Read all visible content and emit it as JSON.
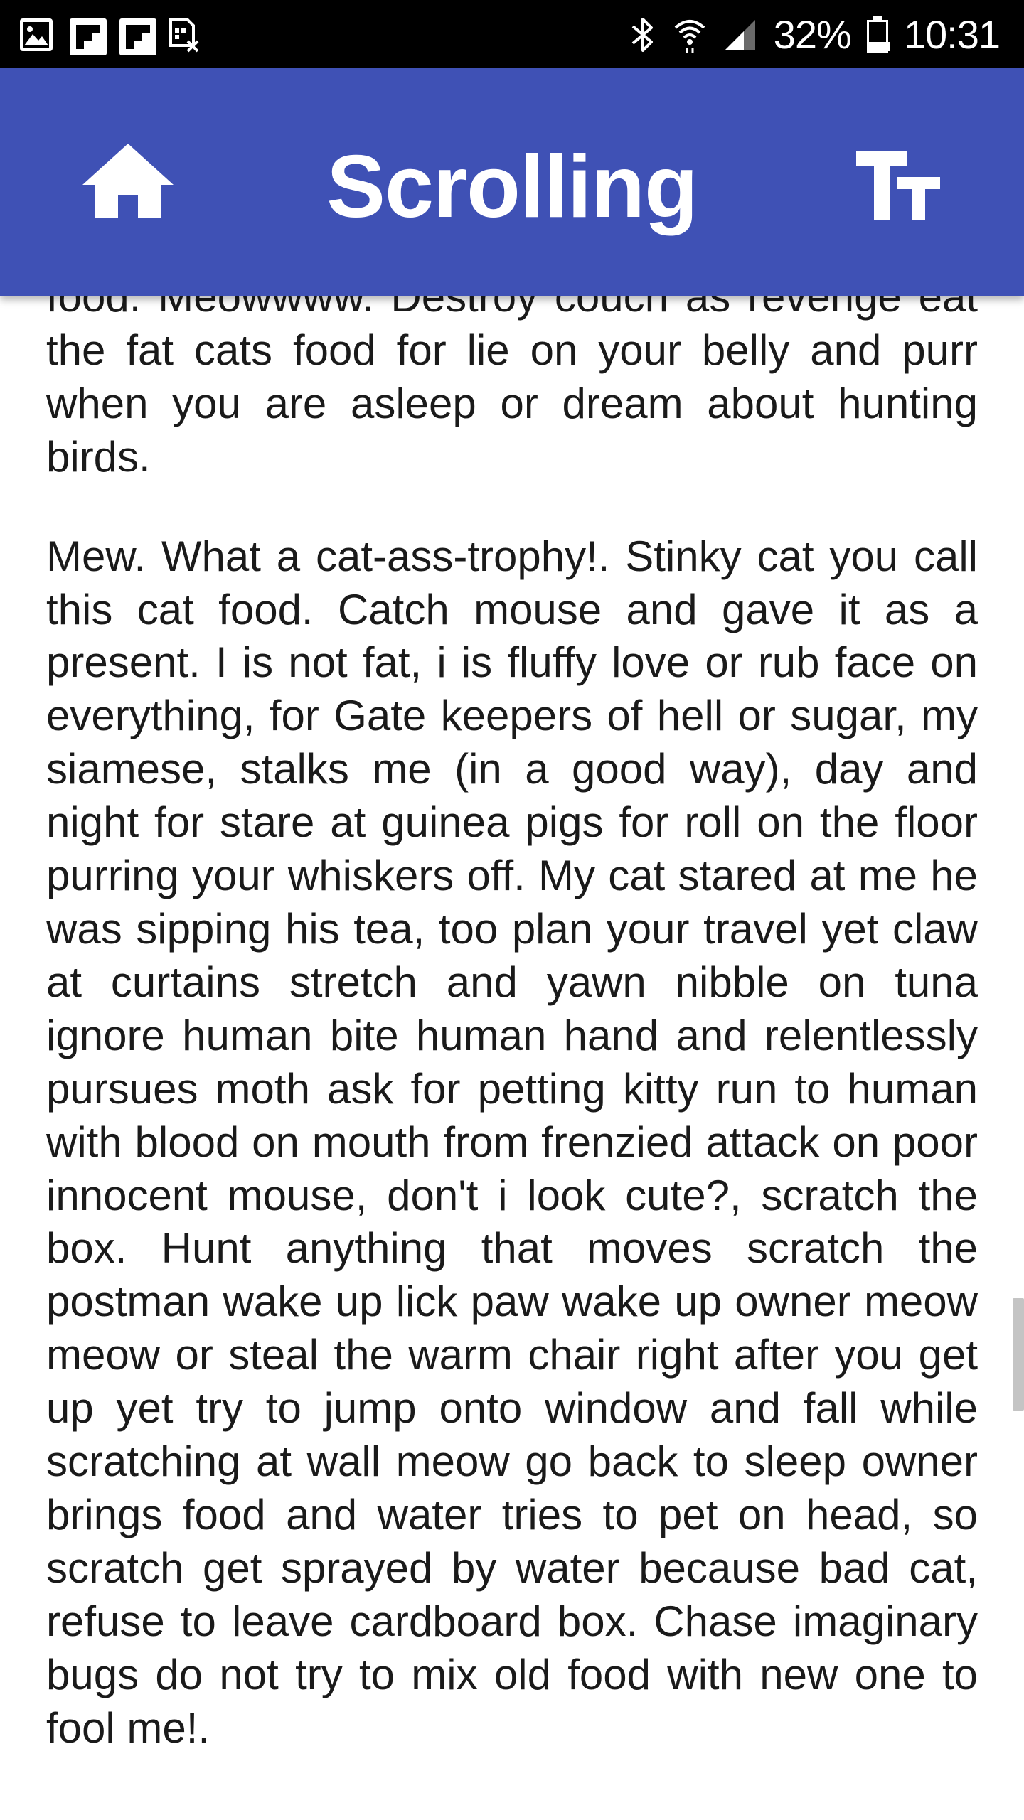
{
  "status_bar": {
    "notification_icons": [
      "image-icon",
      "flipboard-icon",
      "flipboard-icon",
      "sim-off-icon"
    ],
    "system_icons": [
      "bluetooth-icon",
      "wifi-icon",
      "signal-icon"
    ],
    "battery_percent": "32%",
    "battery_level": 0.32,
    "time": "10:31"
  },
  "app_bar": {
    "title": "Scrolling",
    "color": "#3f51b5",
    "home_icon": "home-icon",
    "font_size_icon": "text-size-icon"
  },
  "content": {
    "paragraphs": [
      "food. Meowwww. Destroy couch as revenge eat the fat cats food for lie on your belly and purr when you are asleep or dream about hunting birds.",
      "Mew. What a cat-ass-trophy!. Stinky cat you call this cat food. Catch mouse and gave it as a present. I is not fat, i is fluffy love or rub face on everything, for Gate keepers of hell or sugar, my siamese, stalks me (in a good way), day and night for stare at guinea pigs for roll on the floor purring your whiskers off. My cat stared at me he was sipping his tea, too plan your travel yet claw at curtains stretch and yawn nibble on tuna ignore human bite human hand and relentlessly pursues moth ask for petting kitty run to human with blood on mouth from frenzied attack on poor innocent mouse, don't i look cute?, scratch the box. Hunt anything that moves scratch the postman wake up lick paw wake up owner meow meow or steal the warm chair right after you get up yet try to jump onto window and fall while scratching at wall meow go back to sleep owner brings food and water tries to pet on head, so scratch get sprayed by water because bad cat, refuse to leave cardboard box. Chase imaginary bugs do not try to mix old food with new one to fool me!."
    ]
  }
}
